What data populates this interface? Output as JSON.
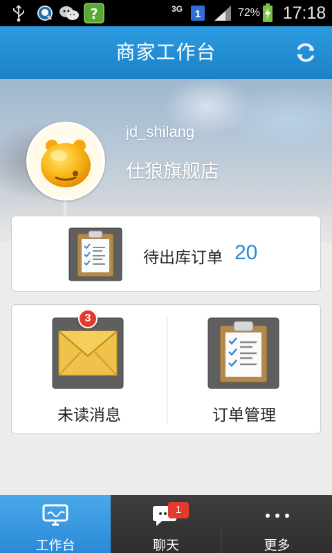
{
  "status_bar": {
    "network_type": "3G",
    "sim_indicator": "1",
    "battery_percent": "72%",
    "time": "17:18",
    "icons": [
      "usb-icon",
      "qq-icon",
      "wechat-icon",
      "unknown-app-icon",
      "signal-icon",
      "battery-charging-icon"
    ]
  },
  "header": {
    "title": "商家工作台",
    "refresh_icon": "refresh-icon"
  },
  "profile": {
    "username": "jd_shilang",
    "shop_name": "仕狼旗舰店",
    "avatar_icon": "mascot-avatar-icon"
  },
  "pending_orders": {
    "label": "待出库订单",
    "count": "20",
    "icon": "clipboard-icon"
  },
  "actions": [
    {
      "label": "未读消息",
      "badge": "3",
      "icon": "envelope-icon"
    },
    {
      "label": "订单管理",
      "icon": "clipboard-icon"
    }
  ],
  "bottom_nav": [
    {
      "label": "工作台",
      "icon": "monitor-icon",
      "active": true
    },
    {
      "label": "聊天",
      "icon": "chat-bubble-icon",
      "badge": "1"
    },
    {
      "label": "更多",
      "icon": "more-dots-icon"
    }
  ],
  "colors": {
    "header_blue": "#1a82c8",
    "accent_blue": "#2a8ad6",
    "badge_red": "#e33a2e",
    "nav_dark": "#333333"
  }
}
